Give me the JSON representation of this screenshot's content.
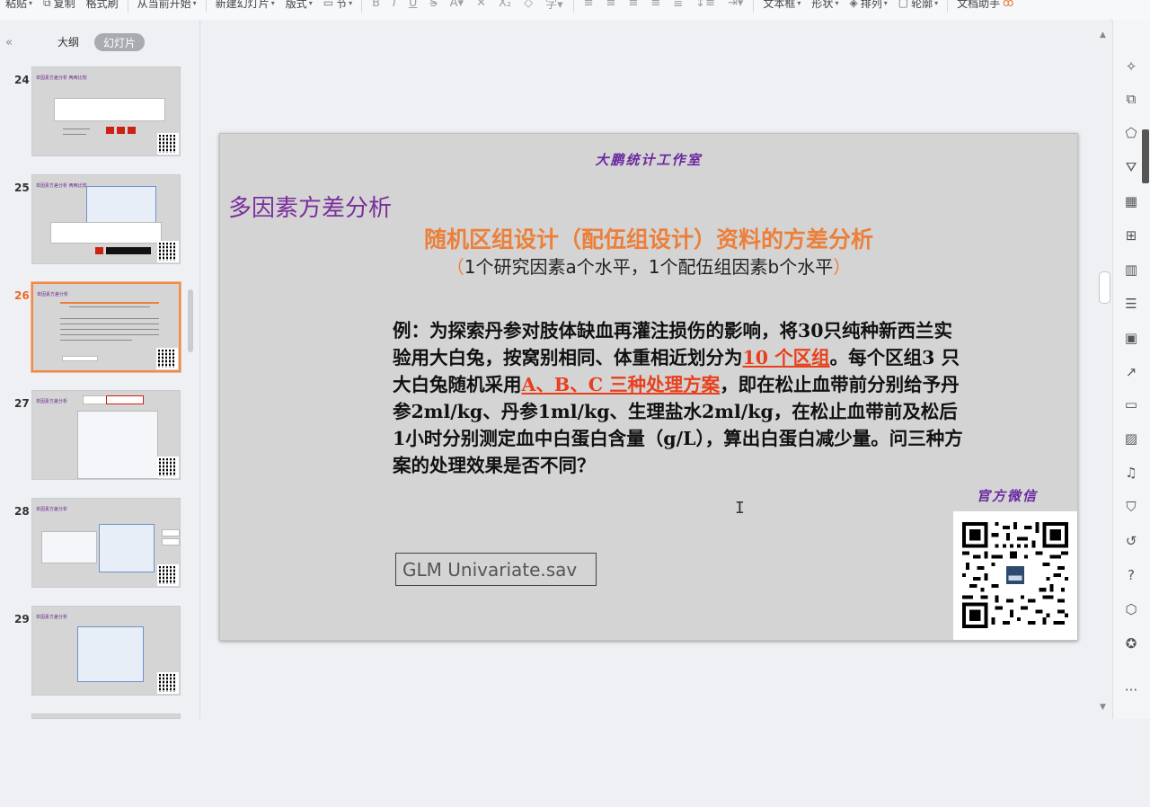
{
  "toolbar": {
    "items": [
      {
        "label": "粘贴",
        "has_caret": true
      },
      {
        "label": "复制",
        "has_caret": false
      },
      {
        "label": "格式刷",
        "has_caret": false
      },
      {
        "label": "从当前开始",
        "has_caret": true
      },
      {
        "label": "新建幻灯片",
        "has_caret": true
      },
      {
        "label": "版式",
        "has_caret": true
      },
      {
        "label": "节",
        "has_caret": true
      },
      {
        "label": "文本框",
        "has_caret": true
      },
      {
        "label": "形状",
        "has_caret": true
      },
      {
        "label": "排列",
        "has_caret": true
      },
      {
        "label": "轮廓",
        "has_caret": true
      },
      {
        "label": "文档助手",
        "has_caret": false
      }
    ]
  },
  "left_panel": {
    "tab_outline": "大纲",
    "tab_slides": "幻灯片",
    "collapse_glyph": "«",
    "thumbnails": [
      {
        "num": "24",
        "title": "单因素方差分析 两两比较"
      },
      {
        "num": "25",
        "title": "单因素方差分析 两两比较"
      },
      {
        "num": "26",
        "title": "单因素方差分析"
      },
      {
        "num": "27",
        "title": "单因素方差分析"
      },
      {
        "num": "28",
        "title": "单因素方差分析"
      },
      {
        "num": "29",
        "title": "单因素方差分析"
      }
    ]
  },
  "slide": {
    "header": "大鹏统计工作室",
    "title": "多因素方差分析",
    "subtitle": "随机区组设计（配伍组设计）资料的方差分析",
    "subtitle2_open": "（",
    "subtitle2_text": "1个研究因素a个水平，1个配伍组因素b个水平",
    "subtitle2_close": "）",
    "example_part1": "例：为探索丹参对肢体缺血再灌注损伤的影响，将30只纯种新西兰实验用大白兔，按窝别相同、体重相近划分为",
    "example_hl1": "10 个区组",
    "example_part2": "。每个区组3 只大白兔随机采用",
    "example_hl2": "A、B、C 三种处理方案",
    "example_part3": "，即在松止血带前分别给予丹参2ml/kg、丹参1ml/kg、生理盐水2ml/kg，在松止血带前及松后1小时分别测定血中白蛋白含量（g/L），算出白蛋白减少量。问三种方案的处理效果是否不同？",
    "wechat_label": "官方微信",
    "file_name": "GLM Univariate.sav"
  },
  "colors": {
    "title_purple": "#7b2f9c",
    "subtitle_orange": "#ec7f3a",
    "highlight_red": "#e8401c",
    "slide_bg": "#d4d4d4",
    "active_thumb_border": "#f08a4b"
  },
  "right_sidebar": {
    "icons": [
      "pin-icon",
      "copy-icon",
      "shapes-icon",
      "paint-icon",
      "table-icon",
      "grid-icon",
      "chart-icon",
      "adjust-icon",
      "picture-import-icon",
      "share-icon",
      "archive-icon",
      "image-icon",
      "audio-icon",
      "shield-icon",
      "history-icon",
      "help-icon",
      "cube-icon",
      "badge-icon"
    ],
    "more_glyph": "···"
  }
}
